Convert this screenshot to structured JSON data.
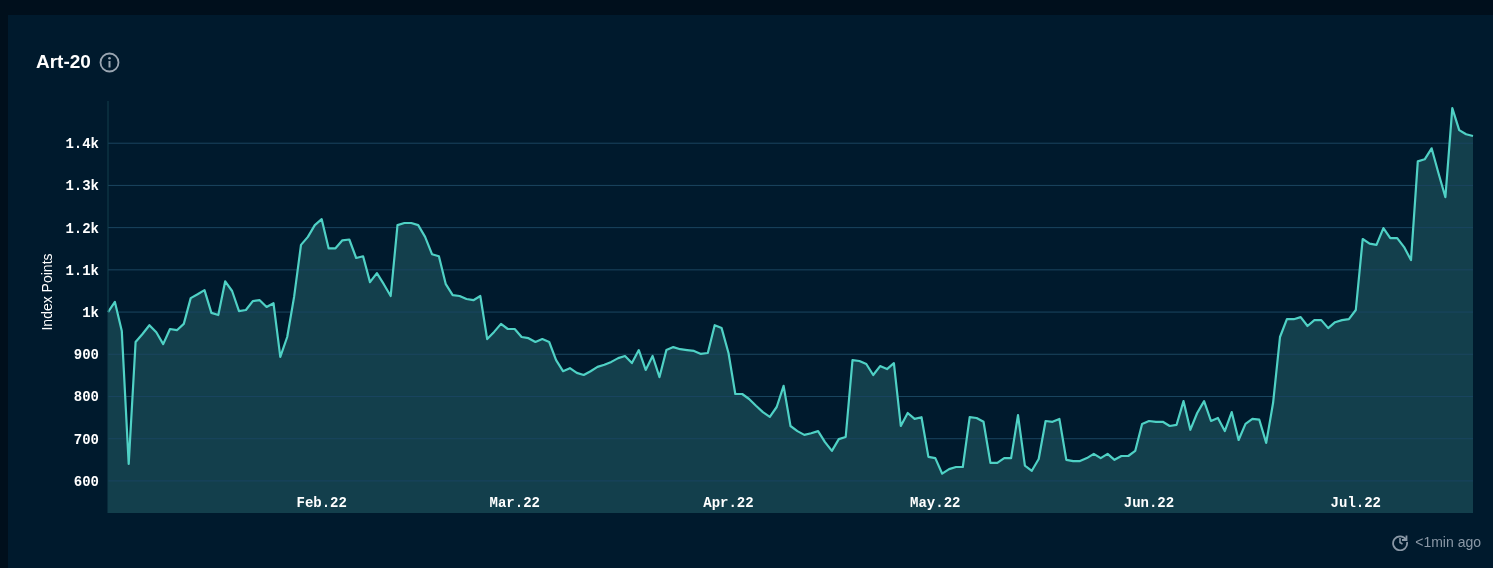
{
  "card": {
    "title": "Art-20",
    "updated": "<1min ago"
  },
  "chart_data": {
    "type": "area",
    "ylabel": "Index Points",
    "grid": true,
    "ylim": [
      524,
      1500
    ],
    "categories": [
      null,
      null,
      null,
      null,
      null,
      null,
      null,
      null,
      null,
      null,
      null,
      null,
      null,
      null,
      null,
      null,
      null,
      null,
      null,
      null,
      null,
      null,
      null,
      null,
      null,
      null,
      null,
      null,
      null,
      null,
      null,
      "Feb.22",
      null,
      null,
      null,
      null,
      null,
      null,
      null,
      null,
      null,
      null,
      null,
      null,
      null,
      null,
      null,
      null,
      null,
      null,
      null,
      null,
      null,
      null,
      null,
      null,
      null,
      null,
      null,
      "Mar.22",
      null,
      null,
      null,
      null,
      null,
      null,
      null,
      null,
      null,
      null,
      null,
      null,
      null,
      null,
      null,
      null,
      null,
      null,
      null,
      null,
      null,
      null,
      null,
      null,
      null,
      null,
      null,
      null,
      null,
      null,
      "Apr.22",
      null,
      null,
      null,
      null,
      null,
      null,
      null,
      null,
      null,
      null,
      null,
      null,
      null,
      null,
      null,
      null,
      null,
      null,
      null,
      null,
      null,
      null,
      null,
      null,
      null,
      null,
      null,
      null,
      null,
      "May.22",
      null,
      null,
      null,
      null,
      null,
      null,
      null,
      null,
      null,
      null,
      null,
      null,
      null,
      null,
      null,
      null,
      null,
      null,
      null,
      null,
      null,
      null,
      null,
      null,
      null,
      null,
      null,
      null,
      null,
      null,
      "Jun.22",
      null,
      null,
      null,
      null,
      null,
      null,
      null,
      null,
      null,
      null,
      null,
      null,
      null,
      null,
      null,
      null,
      null,
      null,
      null,
      null,
      null,
      null,
      null,
      null,
      null,
      null,
      null,
      null,
      null,
      "Jul.22",
      null,
      null,
      null,
      null,
      null,
      null,
      null,
      null,
      null,
      null,
      null,
      null,
      null,
      null,
      null,
      null,
      null
    ],
    "yticks": [
      {
        "value": 600,
        "label": "600"
      },
      {
        "value": 700,
        "label": "700"
      },
      {
        "value": 800,
        "label": "800"
      },
      {
        "value": 900,
        "label": "900"
      },
      {
        "value": 1000,
        "label": "1k"
      },
      {
        "value": 1100,
        "label": "1.1k"
      },
      {
        "value": 1200,
        "label": "1.2k"
      },
      {
        "value": 1300,
        "label": "1.3k"
      },
      {
        "value": 1400,
        "label": "1.4k"
      }
    ],
    "series": [
      {
        "color": "#4fd1c5",
        "values": [
          1000,
          1024,
          955,
          640,
          929,
          948,
          969,
          952,
          924,
          960,
          957,
          972,
          1033,
          1042,
          1052,
          998,
          993,
          1073,
          1050,
          1002,
          1005,
          1026,
          1028,
          1012,
          1021,
          894,
          941,
          1036,
          1159,
          1178,
          1206,
          1220,
          1151,
          1151,
          1170,
          1172,
          1128,
          1132,
          1071,
          1092,
          1066,
          1038,
          1206,
          1211,
          1211,
          1206,
          1178,
          1137,
          1132,
          1066,
          1040,
          1038,
          1031,
          1028,
          1038,
          936,
          953,
          972,
          960,
          960,
          941,
          938,
          929,
          936,
          929,
          886,
          860,
          867,
          856,
          851,
          860,
          870,
          875,
          882,
          891,
          896,
          879,
          910,
          863,
          896,
          846,
          910,
          917,
          912,
          910,
          908,
          901,
          903,
          969,
          962,
          903,
          806,
          806,
          794,
          778,
          763,
          752,
          775,
          825,
          730,
          718,
          709,
          713,
          718,
          692,
          671,
          699,
          704,
          886,
          884,
          877,
          851,
          872,
          865,
          879,
          730,
          761,
          747,
          751,
          657,
          654,
          617,
          628,
          633,
          633,
          751,
          749,
          740,
          643,
          643,
          654,
          654,
          756,
          636,
          624,
          652,
          742,
          740,
          747,
          650,
          647,
          647,
          654,
          664,
          654,
          664,
          650,
          659,
          659,
          671,
          735,
          742,
          740,
          740,
          730,
          733,
          789,
          721,
          761,
          789,
          742,
          749,
          718,
          763,
          697,
          735,
          747,
          745,
          690,
          785,
          941,
          983,
          983,
          988,
          967,
          981,
          981,
          962,
          976,
          981,
          983,
          1005,
          1173,
          1162,
          1159,
          1199,
          1175,
          1175,
          1154,
          1123,
          1357,
          1362,
          1388,
          1329,
          1272,
          1483,
          1431,
          1421,
          1417
        ]
      }
    ]
  }
}
